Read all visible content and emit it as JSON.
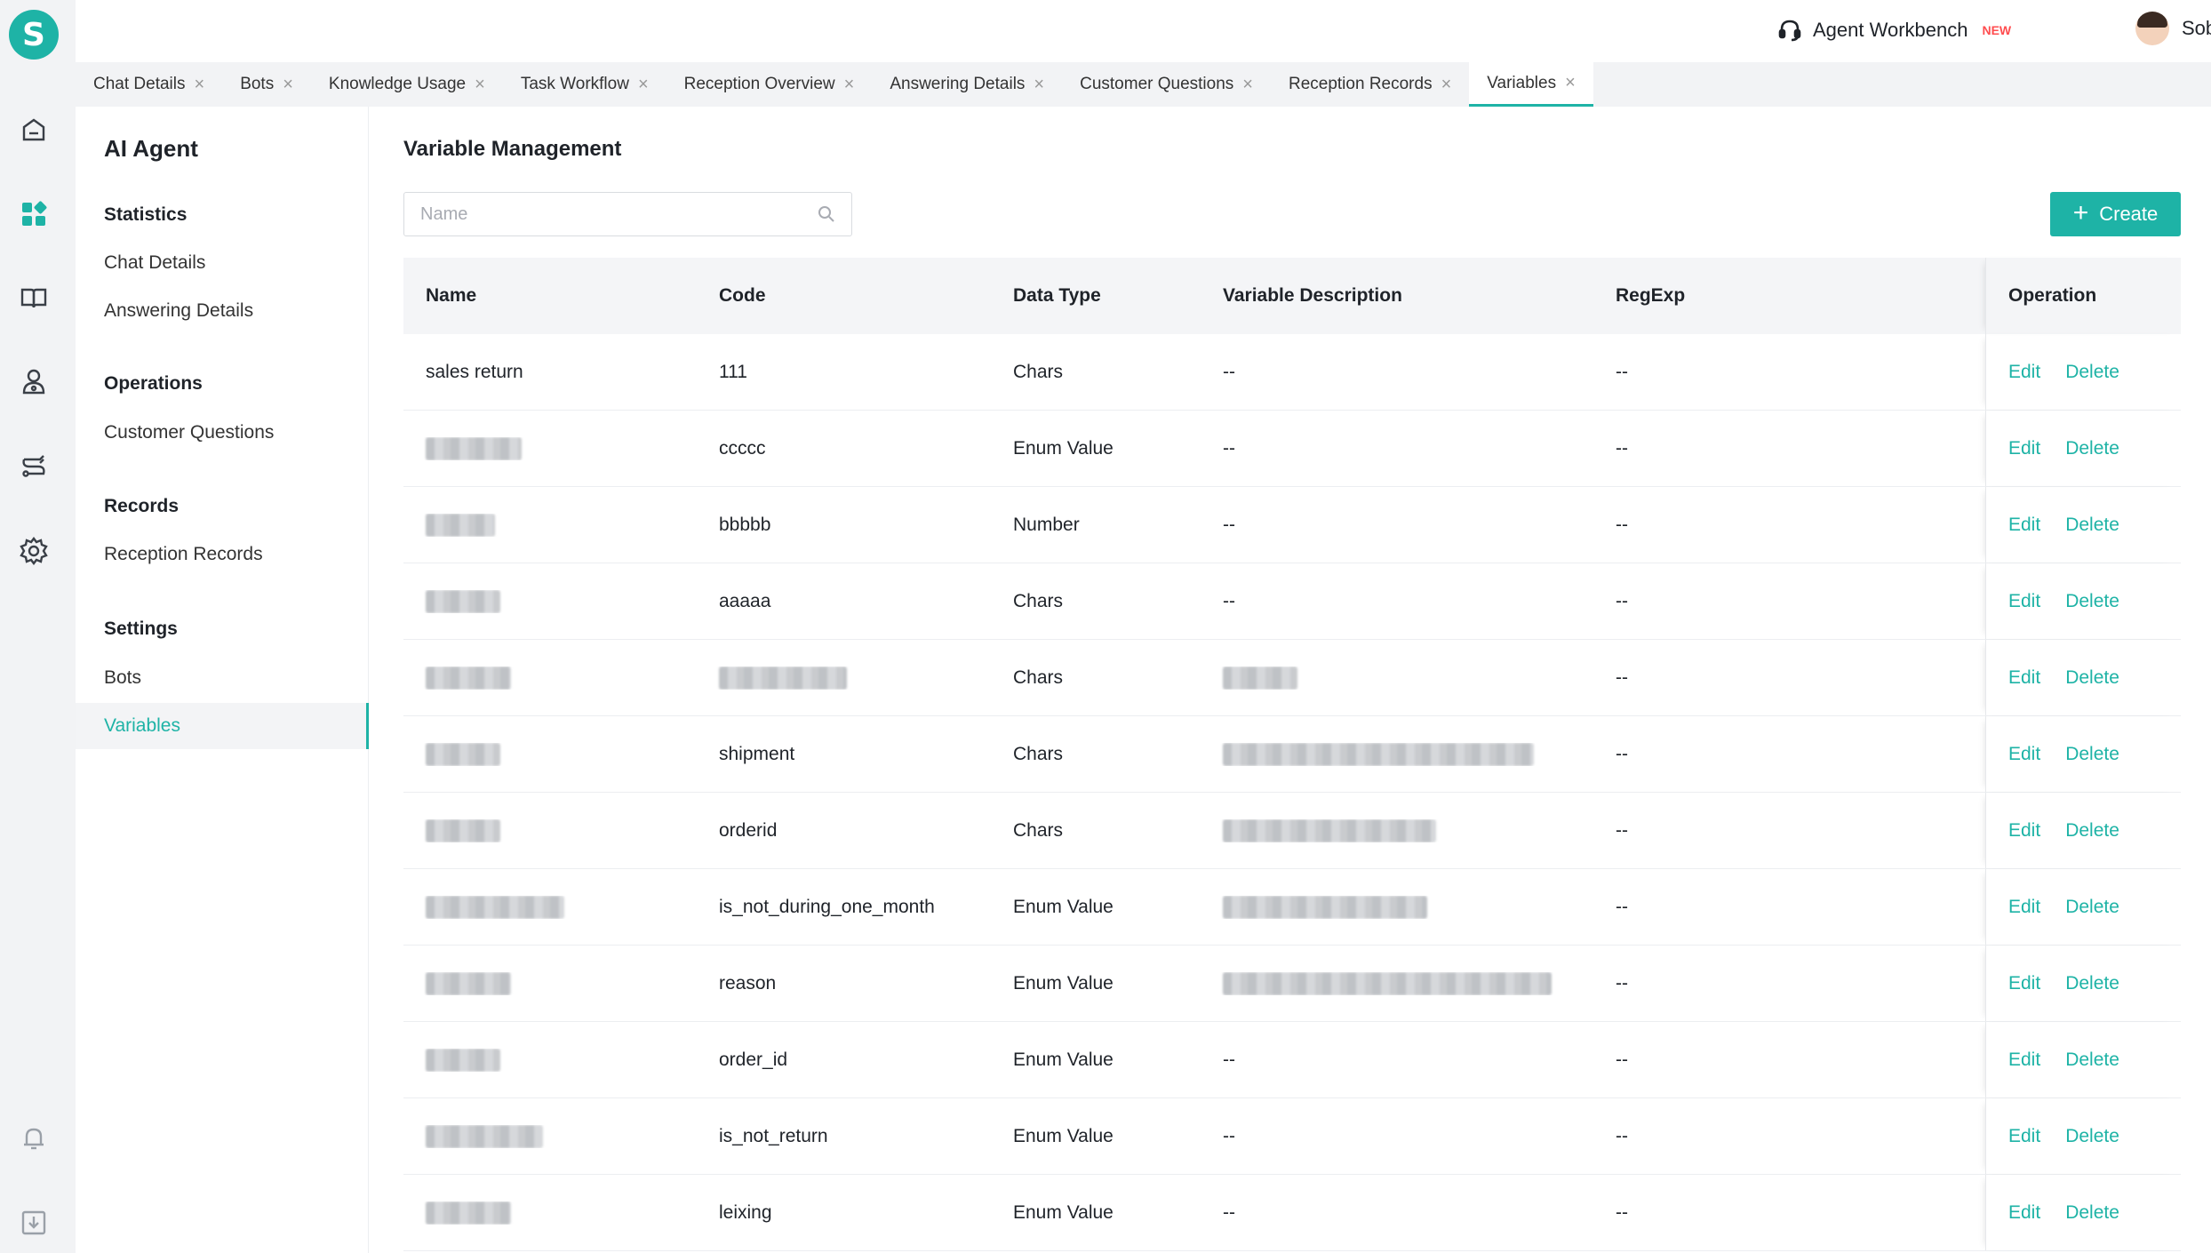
{
  "app": {
    "logo_letter": "S"
  },
  "topbar": {
    "workbench_label": "Agent Workbench",
    "workbench_badge": "NEW",
    "user_name": "Sobot"
  },
  "tabs": [
    {
      "label": "Chat Details",
      "active": false
    },
    {
      "label": "Bots",
      "active": false
    },
    {
      "label": "Knowledge Usage",
      "active": false
    },
    {
      "label": "Task Workflow",
      "active": false
    },
    {
      "label": "Reception Overview",
      "active": false
    },
    {
      "label": "Answering Details",
      "active": false
    },
    {
      "label": "Customer Questions",
      "active": false
    },
    {
      "label": "Reception Records",
      "active": false
    },
    {
      "label": "Variables",
      "active": true
    }
  ],
  "sidebar": {
    "title": "AI Agent",
    "groups": [
      {
        "label": "Statistics",
        "items": [
          "Chat Details",
          "Answering Details"
        ]
      },
      {
        "label": "Operations",
        "items": [
          "Customer Questions"
        ]
      },
      {
        "label": "Records",
        "items": [
          "Reception Records"
        ]
      },
      {
        "label": "Settings",
        "items": [
          "Bots",
          "Variables"
        ]
      }
    ],
    "active_item": "Variables"
  },
  "main": {
    "title": "Variable Management",
    "search_placeholder": "Name",
    "create_label": "Create"
  },
  "table": {
    "columns": [
      "Name",
      "Code",
      "Data Type",
      "Variable Description",
      "RegExp",
      "Operation"
    ],
    "edit_label": "Edit",
    "delete_label": "Delete",
    "rows": [
      {
        "name": "sales return",
        "code": "111",
        "type": "Chars",
        "desc": "--",
        "regexp": "--"
      },
      {
        "name": "",
        "code": "ccccc",
        "type": "Enum Value",
        "desc": "--",
        "regexp": "--"
      },
      {
        "name": "",
        "code": "bbbbb",
        "type": "Number",
        "desc": "--",
        "regexp": "--"
      },
      {
        "name": "",
        "code": "aaaaa",
        "type": "Chars",
        "desc": "--",
        "regexp": "--"
      },
      {
        "name": "",
        "code": "",
        "type": "Chars",
        "desc": "",
        "regexp": "--"
      },
      {
        "name": "",
        "code": "shipment",
        "type": "Chars",
        "desc": "",
        "regexp": "--"
      },
      {
        "name": "",
        "code": "orderid",
        "type": "Chars",
        "desc": "",
        "regexp": "--"
      },
      {
        "name": "",
        "code": "is_not_during_one_month",
        "type": "Enum Value",
        "desc": "",
        "regexp": "--"
      },
      {
        "name": "",
        "code": "reason",
        "type": "Enum Value",
        "desc": "",
        "regexp": "--"
      },
      {
        "name": "",
        "code": "order_id",
        "type": "Enum Value",
        "desc": "--",
        "regexp": "--"
      },
      {
        "name": "",
        "code": "is_not_return",
        "type": "Enum Value",
        "desc": "--",
        "regexp": "--"
      },
      {
        "name": "",
        "code": "leixing",
        "type": "Enum Value",
        "desc": "--",
        "regexp": "--"
      }
    ]
  },
  "rail_icons": [
    "home-icon",
    "dashboard-icon",
    "knowledge-book-icon",
    "user-bot-icon",
    "workflow-icon",
    "settings-gear-icon",
    "bell-icon",
    "download-icon"
  ],
  "colors": {
    "accent": "#1eb3a6",
    "badge_new": "#ff4d4f"
  }
}
